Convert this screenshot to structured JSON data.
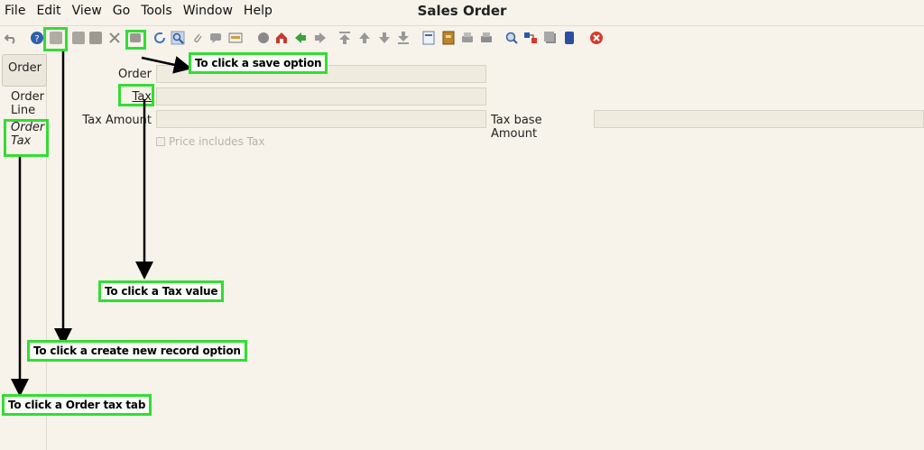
{
  "window": {
    "title": "Sales Order"
  },
  "menu": [
    "File",
    "Edit",
    "View",
    "Go",
    "Tools",
    "Window",
    "Help"
  ],
  "toolbar": {
    "icons": [
      "undo-icon",
      "help-icon",
      "new-record-icon",
      "copy-icon",
      "delete-icon",
      "cut-icon",
      "save-icon",
      "refresh-icon",
      "find-icon",
      "attachment-icon",
      "chat-icon",
      "history-icon",
      "report-icon",
      "home-icon",
      "back-icon",
      "forward-icon",
      "first-record-icon",
      "previous-record-icon",
      "next-record-icon",
      "last-record-icon",
      "detail-icon",
      "archive-icon",
      "print-preview-icon",
      "print-icon",
      "zoom-across-icon",
      "requests-icon",
      "product-info-icon",
      "workflow-icon",
      "end-window-icon"
    ]
  },
  "tabs": {
    "order": "Order",
    "order_line": "Order Line",
    "order_tax": "Order Tax"
  },
  "form": {
    "order_label": "Order",
    "order_value": "",
    "tax_label": "Tax",
    "tax_value": "",
    "tax_amount_label": "Tax Amount",
    "tax_amount_value": "",
    "tax_base_label": "Tax base Amount",
    "tax_base_value": "",
    "price_includes_tax_label": "Price includes Tax"
  },
  "annotations": {
    "save": "To click a save option",
    "tax_value": "To click a Tax value",
    "create_new": "To click a create new record option",
    "order_tax_tab": "To click a Order tax tab"
  },
  "colors": {
    "highlight": "#33dd33",
    "background": "#f7f3ea",
    "field": "#efebdf"
  }
}
